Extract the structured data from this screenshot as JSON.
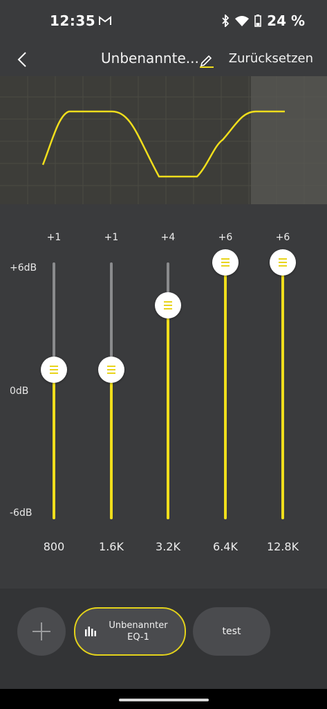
{
  "status_bar": {
    "time": "12:35",
    "battery": "24 %"
  },
  "header": {
    "title": "Unbenannte...",
    "reset_label": "Zurücksetzen"
  },
  "eq": {
    "db_labels": {
      "top": "+6dB",
      "middle": "0dB",
      "bottom": "-6dB"
    },
    "bands": [
      {
        "frequency": "800",
        "gain_label": "+1",
        "gain_db": 1
      },
      {
        "frequency": "1.6K",
        "gain_label": "+1",
        "gain_db": 1
      },
      {
        "frequency": "3.2K",
        "gain_label": "+4",
        "gain_db": 4
      },
      {
        "frequency": "6.4K",
        "gain_label": "+6",
        "gain_db": 6
      },
      {
        "frequency": "12.8K",
        "gain_label": "+6",
        "gain_db": 6
      }
    ]
  },
  "presets": {
    "active": {
      "line1": "Unbenannter",
      "line2": "EQ-1"
    },
    "other": "test"
  },
  "colors": {
    "accent": "#f0de1c",
    "background": "#3a3b3d",
    "curve_background": "#3d3d39"
  },
  "icons": [
    "gmail-icon",
    "bluetooth-icon",
    "wifi-icon",
    "battery-icon",
    "back-arrow-icon",
    "edit-pencil-icon",
    "plus-icon",
    "equalizer-bars-icon"
  ]
}
